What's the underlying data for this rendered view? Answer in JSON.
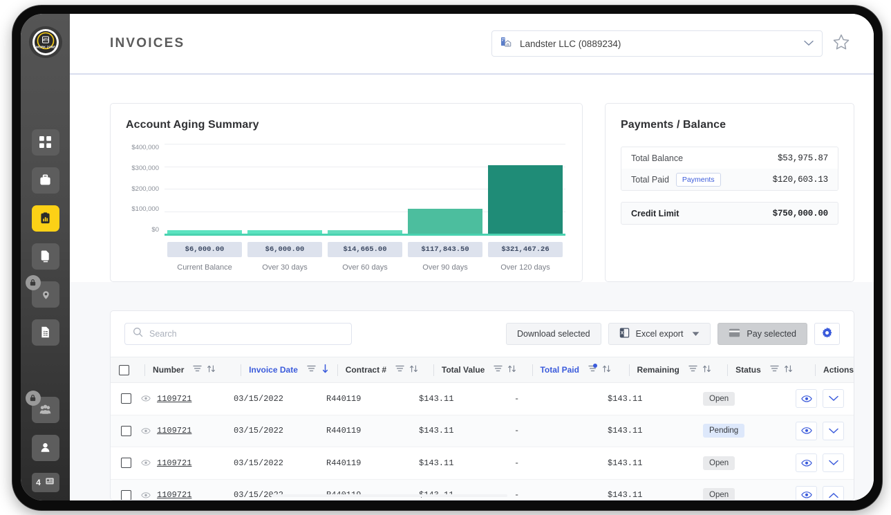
{
  "header": {
    "title": "INVOICES",
    "customer_select": {
      "value": "Landster LLC (0889234)",
      "icon": "building-icon",
      "chevron": "chevron-down-icon"
    },
    "favorite_icon": "star-icon"
  },
  "sidebar": {
    "logo": {
      "name": "work-zone-logo",
      "top_text": "MTS",
      "bottom_text": "WORK ZONE"
    },
    "items": [
      {
        "name": "dashboard",
        "icon": "grid-icon",
        "active": false,
        "locked": false
      },
      {
        "name": "jobs",
        "icon": "briefcase-icon",
        "active": false,
        "locked": false
      },
      {
        "name": "invoices",
        "icon": "clipboard-chart-icon",
        "active": true,
        "locked": false
      },
      {
        "name": "documents",
        "icon": "copy-pages-icon",
        "active": false,
        "locked": false
      },
      {
        "name": "locations",
        "icon": "map-pin-icon",
        "active": false,
        "locked": true
      },
      {
        "name": "reports",
        "icon": "document-list-icon",
        "active": false,
        "locked": false
      },
      {
        "name": "users",
        "icon": "people-icon",
        "active": false,
        "locked": true
      },
      {
        "name": "account",
        "icon": "person-icon",
        "active": false,
        "locked": false
      }
    ],
    "counter": {
      "count": "4",
      "icon": "calendar-icon"
    }
  },
  "aging_card": {
    "title": "Account Aging Summary"
  },
  "chart_data": {
    "type": "bar",
    "title": "Account Aging Summary",
    "categories": [
      "Current Balance",
      "Over 30 days",
      "Over 60 days",
      "Over 90 days",
      "Over 120 days"
    ],
    "values": [
      6000.0,
      6000.0,
      14665.0,
      117843.5,
      321467.26
    ],
    "value_labels": [
      "$6,000.00",
      "$6,000.00",
      "$14,665.00",
      "$117,843.50",
      "$321,467.26"
    ],
    "bar_colors": [
      "#5BE3C0",
      "#5BE3C0",
      "#63DCBC",
      "#4CBE9E",
      "#1F8C77"
    ],
    "ytick_labels": [
      "$400,000",
      "$300,000",
      "$200,000",
      "$100,000",
      "$0"
    ],
    "yticks": [
      400000,
      300000,
      200000,
      100000,
      0
    ],
    "ylim": [
      0,
      420000
    ],
    "xlabel": "",
    "ylabel": "",
    "grid": true,
    "legend": "none"
  },
  "payments_card": {
    "title": "Payments / Balance",
    "rows": [
      {
        "label": "Total Balance",
        "amount": "$53,975.87",
        "chip": null
      },
      {
        "label": "Total Paid",
        "amount": "$120,603.13",
        "chip": "Payments"
      }
    ],
    "credit": {
      "label": "Credit Limit",
      "amount": "$750,000.00"
    }
  },
  "toolbar": {
    "search_placeholder": "Search",
    "search_value": "",
    "search_icon": "search-icon",
    "download_label": "Download selected",
    "excel_label": "Excel export",
    "excel_icon": "excel-icon",
    "excel_chevron": "chevron-down-icon",
    "pay_label": "Pay selected",
    "pay_icon": "credit-card-icon",
    "settings_icon": "gear-icon"
  },
  "table": {
    "columns": [
      {
        "key": "checkbox",
        "label": "",
        "sorted": false,
        "filtered": false
      },
      {
        "key": "number",
        "label": "Number",
        "sorted": false,
        "filtered": false
      },
      {
        "key": "invoice_date",
        "label": "Invoice Date",
        "sorted": true,
        "sort_dir": "desc",
        "filtered": false
      },
      {
        "key": "contract",
        "label": "Contract #",
        "sorted": false,
        "filtered": false
      },
      {
        "key": "total_value",
        "label": "Total Value",
        "sorted": false,
        "filtered": false
      },
      {
        "key": "total_paid",
        "label": "Total Paid",
        "sorted": true,
        "filtered": true
      },
      {
        "key": "remaining",
        "label": "Remaining",
        "sorted": false,
        "filtered": false
      },
      {
        "key": "status",
        "label": "Status",
        "sorted": false,
        "filtered": false
      },
      {
        "key": "actions",
        "label": "Actions",
        "sorted": false,
        "filtered": false
      }
    ],
    "rows": [
      {
        "checked": false,
        "number": "1109721",
        "invoice_date": "03/15/2022",
        "contract": "R440119",
        "total_value": "$143.11",
        "total_paid": "-",
        "remaining": "$143.11",
        "status": "Open",
        "status_type": "open",
        "expand": "chevron-down-icon"
      },
      {
        "checked": false,
        "number": "1109721",
        "invoice_date": "03/15/2022",
        "contract": "R440119",
        "total_value": "$143.11",
        "total_paid": "-",
        "remaining": "$143.11",
        "status": "Pending",
        "status_type": "pending",
        "expand": "chevron-down-icon"
      },
      {
        "checked": false,
        "number": "1109721",
        "invoice_date": "03/15/2022",
        "contract": "R440119",
        "total_value": "$143.11",
        "total_paid": "-",
        "remaining": "$143.11",
        "status": "Open",
        "status_type": "open",
        "expand": "chevron-down-icon"
      },
      {
        "checked": false,
        "number": "1109721",
        "invoice_date": "03/15/2022",
        "contract": "R440119",
        "total_value": "$143.11",
        "total_paid": "-",
        "remaining": "$143.11",
        "status": "Open",
        "status_type": "open",
        "expand": "chevron-up-icon"
      }
    ],
    "row_icons": {
      "preview": "eye-icon",
      "view": "eye-icon"
    }
  },
  "colors": {
    "accent_yellow": "#FCD116",
    "link_blue": "#3B5BDB",
    "teal_dark": "#1F8C77",
    "teal_light": "#5BE3C0"
  }
}
